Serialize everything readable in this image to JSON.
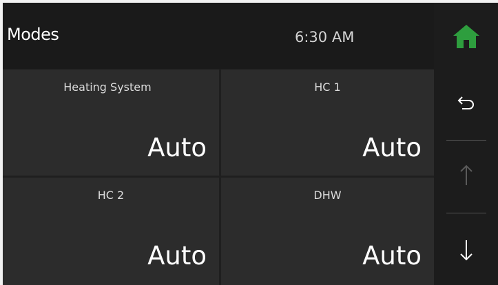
{
  "header": {
    "title": "Modes",
    "time": "6:30 AM"
  },
  "tiles": [
    {
      "label": "Heating System",
      "value": "Auto"
    },
    {
      "label": "HC 1",
      "value": "Auto"
    },
    {
      "label": "HC 2",
      "value": "Auto"
    },
    {
      "label": "DHW",
      "value": "Auto"
    }
  ],
  "sidebar": {
    "icons": [
      "home-icon",
      "back-arrow-icon",
      "up-arrow-icon",
      "down-arrow-icon"
    ],
    "home_color": "#2e9e3e",
    "up_disabled_color": "#5a5a5a"
  }
}
